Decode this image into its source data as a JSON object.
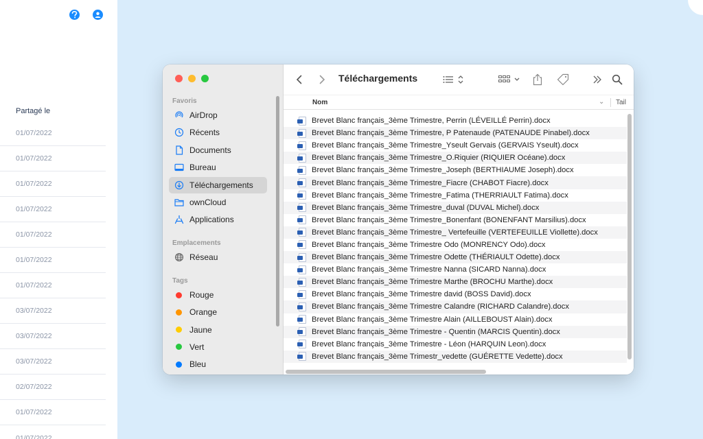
{
  "web": {
    "help_icon": "question-circle-icon",
    "user_icon": "user-circle-icon",
    "shared_header": "Partagé le",
    "shared_dates": [
      "01/07/2022",
      "01/07/2022",
      "01/07/2022",
      "01/07/2022",
      "01/07/2022",
      "01/07/2022",
      "01/07/2022",
      "03/07/2022",
      "03/07/2022",
      "03/07/2022",
      "02/07/2022",
      "01/07/2022",
      "01/07/2022"
    ]
  },
  "finder": {
    "title": "Téléchargements",
    "sidebar": {
      "favorites_label": "Favoris",
      "favorites": [
        {
          "label": "AirDrop",
          "icon": "airdrop-icon"
        },
        {
          "label": "Récents",
          "icon": "clock-icon"
        },
        {
          "label": "Documents",
          "icon": "document-icon"
        },
        {
          "label": "Bureau",
          "icon": "desktop-icon"
        },
        {
          "label": "Téléchargements",
          "icon": "download-icon",
          "selected": true
        },
        {
          "label": "ownCloud",
          "icon": "folder-icon"
        },
        {
          "label": "Applications",
          "icon": "applications-icon"
        }
      ],
      "locations_label": "Emplacements",
      "locations": [
        {
          "label": "Réseau",
          "icon": "globe-icon"
        }
      ],
      "tags_label": "Tags",
      "tags": [
        {
          "label": "Rouge",
          "color": "#ff3b30"
        },
        {
          "label": "Orange",
          "color": "#ff9500"
        },
        {
          "label": "Jaune",
          "color": "#ffcc00"
        },
        {
          "label": "Vert",
          "color": "#28c840"
        },
        {
          "label": "Bleu",
          "color": "#007aff"
        }
      ]
    },
    "columns": {
      "name": "Nom",
      "size": "Tail"
    },
    "files": [
      "Brevet Blanc français_3ème Trimestre, Perrin (LÉVEILLÉ Perrin).docx",
      "Brevet Blanc français_3ème Trimestre, P Patenaude (PATENAUDE Pinabel).docx",
      "Brevet Blanc français_3ème Trimestre_Yseult Gervais (GERVAIS Yseult).docx",
      "Brevet Blanc français_3ème Trimestre_O.Riquier (RIQUIER Océane).docx",
      "Brevet Blanc français_3ème Trimestre_Joseph (BERTHIAUME Joseph).docx",
      "Brevet Blanc français_3ème Trimestre_Fiacre (CHABOT Fiacre).docx",
      "Brevet Blanc français_3ème Trimestre_Fatima (THERRIAULT Fatima).docx",
      "Brevet Blanc français_3ème Trimestre_duval (DUVAL Michel).docx",
      "Brevet Blanc français_3ème Trimestre_Bonenfant (BONENFANT Marsilius).docx",
      "Brevet Blanc français_3ème Trimestre_ Vertefeuille (VERTEFEUILLE Viollette).docx",
      "Brevet Blanc français_3ème Trimestre Odo (MONRENCY Odo).docx",
      "Brevet Blanc français_3ème Trimestre Odette (THÉRIAULT Odette).docx",
      "Brevet Blanc français_3ème Trimestre Nanna (SICARD Nanna).docx",
      "Brevet Blanc français_3ème Trimestre Marthe (BROCHU Marthe).docx",
      "Brevet Blanc français_3ème Trimestre david (BOSS David).docx",
      "Brevet Blanc français_3ème Trimestre Calandre (RICHARD Calandre).docx",
      "Brevet Blanc français_3ème Trimestre Alain (AILLEBOUST Alain).docx",
      "Brevet Blanc français_3ème Trimestre - Quentin (MARCIS Quentin).docx",
      "Brevet Blanc français_3ème Trimestre - Léon (HARQUIN Leon).docx",
      "Brevet Blanc français_3ème Trimestr_vedette (GUÉRETTE Vedette).docx"
    ]
  }
}
